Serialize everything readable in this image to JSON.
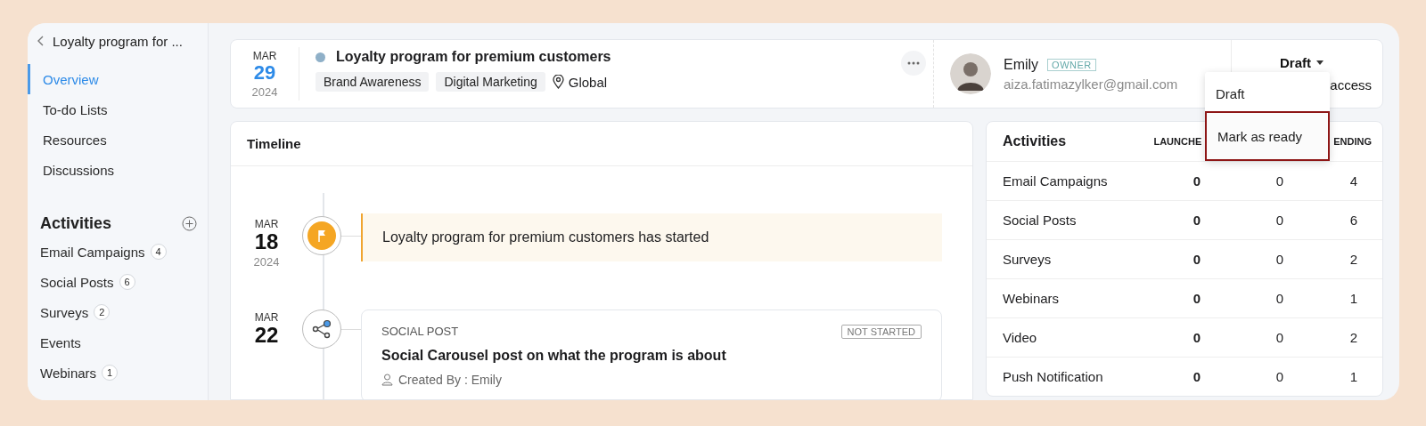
{
  "sidebar": {
    "back_title": "Loyalty program for ...",
    "nav": [
      {
        "label": "Overview",
        "selected": true
      },
      {
        "label": "To-do Lists",
        "selected": false
      },
      {
        "label": "Resources",
        "selected": false
      },
      {
        "label": "Discussions",
        "selected": false
      }
    ],
    "activities_heading": "Activities",
    "activities": [
      {
        "label": "Email Campaigns",
        "count": "4"
      },
      {
        "label": "Social Posts",
        "count": "6"
      },
      {
        "label": "Surveys",
        "count": "2"
      },
      {
        "label": "Events"
      },
      {
        "label": "Webinars",
        "count": "1"
      }
    ]
  },
  "header": {
    "date": {
      "month": "MAR",
      "day": "29",
      "year": "2024"
    },
    "title": "Loyalty program for premium customers",
    "tags": [
      "Brand Awareness",
      "Digital Marketing"
    ],
    "location": "Global",
    "owner": {
      "name": "Emily",
      "role": "OWNER",
      "email": "aiza.fatimazylker@gmail.com"
    },
    "status": {
      "label": "Draft",
      "caption": "access"
    }
  },
  "status_menu": {
    "items": [
      {
        "label": "Draft",
        "selected": false
      },
      {
        "label": "Mark as ready",
        "selected": true
      }
    ]
  },
  "timeline": {
    "title": "Timeline",
    "events": [
      {
        "kind": "milestone",
        "month": "MAR",
        "day": "18",
        "year": "2024",
        "text": "Loyalty program for premium customers has started"
      },
      {
        "kind": "post",
        "month": "MAR",
        "day": "22",
        "type": "SOCIAL POST",
        "status": "NOT STARTED",
        "title": "Social Carousel post on what the program is about",
        "created_by": "Created By : Emily"
      }
    ]
  },
  "activities": {
    "title": "Activities",
    "column_2": "LAUNCHE",
    "column_4": "ENDING",
    "rows": [
      {
        "name": "Email Campaigns",
        "cells": [
          "0",
          "0",
          "4"
        ]
      },
      {
        "name": "Social Posts",
        "cells": [
          "0",
          "0",
          "6"
        ]
      },
      {
        "name": "Surveys",
        "cells": [
          "0",
          "0",
          "2"
        ]
      },
      {
        "name": "Webinars",
        "cells": [
          "0",
          "0",
          "1"
        ]
      },
      {
        "name": "Video",
        "cells": [
          "0",
          "0",
          "2"
        ]
      },
      {
        "name": "Push Notification",
        "cells": [
          "0",
          "0",
          "1"
        ]
      }
    ]
  }
}
